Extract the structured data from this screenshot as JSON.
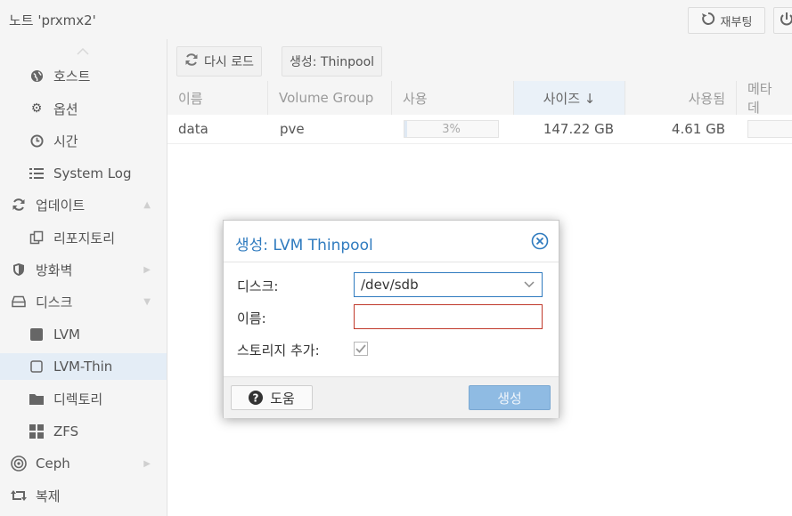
{
  "header": {
    "node_title": "노트 'prxmx2'",
    "reboot_label": "재부팅"
  },
  "sidebar": {
    "items": [
      {
        "label": "호스트",
        "icon": "globe-icon"
      },
      {
        "label": "옵션",
        "icon": "gear-icon"
      },
      {
        "label": "시간",
        "icon": "clock-icon"
      },
      {
        "label": "System Log",
        "icon": "list-icon"
      },
      {
        "label": "업데이트",
        "icon": "refresh-icon"
      },
      {
        "label": "리포지토리",
        "icon": "copy-icon"
      },
      {
        "label": "방화벽",
        "icon": "shield-icon"
      },
      {
        "label": "디스크",
        "icon": "drive-icon"
      },
      {
        "label": "LVM",
        "icon": "square-icon"
      },
      {
        "label": "LVM-Thin",
        "icon": "square-outline-icon"
      },
      {
        "label": "디렉토리",
        "icon": "folder-icon"
      },
      {
        "label": "ZFS",
        "icon": "grid-icon"
      },
      {
        "label": "Ceph",
        "icon": "ceph-icon"
      },
      {
        "label": "복제",
        "icon": "retweet-icon"
      }
    ]
  },
  "toolbar": {
    "reload_label": "다시 로드",
    "create_label": "생성: Thinpool"
  },
  "grid": {
    "columns": [
      "이름",
      "Volume Group",
      "사용",
      "사이즈 ↓",
      "사용됨",
      "메타데"
    ],
    "rows": [
      {
        "name": "data",
        "vg": "pve",
        "usage": "3%",
        "usage_fraction": 0.03,
        "size": "147.22 GB",
        "used": "4.61 GB"
      }
    ]
  },
  "dialog": {
    "title": "생성: LVM Thinpool",
    "disk_label": "디스크:",
    "disk_value": "/dev/sdb",
    "name_label": "이름:",
    "name_value": "",
    "add_storage_label": "스토리지 추가:",
    "add_storage_checked": true,
    "help_label": "도움",
    "create_label": "생성"
  },
  "colors": {
    "accent": "#2f7bbf",
    "error_border": "#c0392b",
    "selected_row": "#e4edf6",
    "create_button": "#8fbbe3"
  }
}
